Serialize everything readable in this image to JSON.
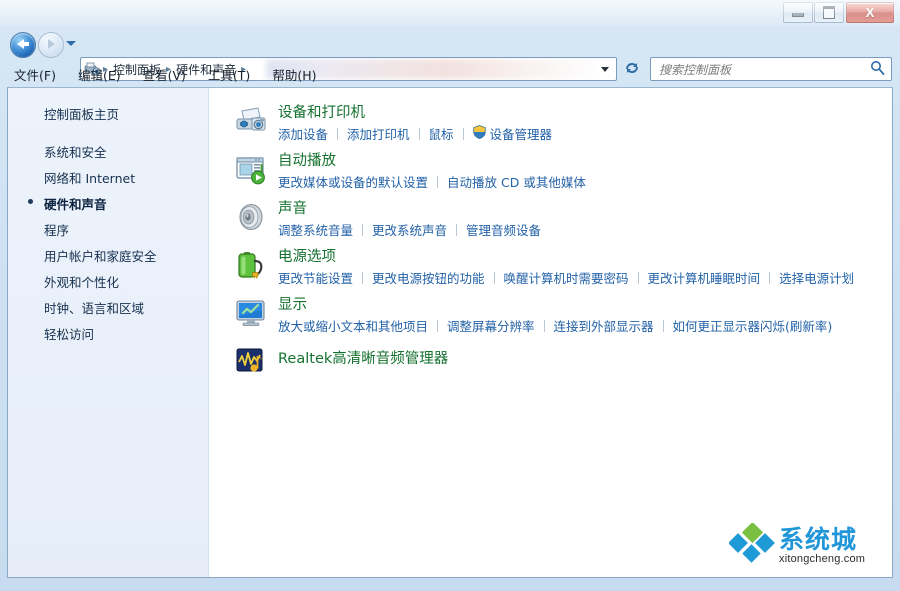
{
  "window": {
    "controls": {
      "minimize_label": "–",
      "maximize_label": "",
      "close_label": "X"
    }
  },
  "nav": {
    "back_tooltip": "后退",
    "forward_tooltip": "前进",
    "breadcrumbs": [
      "控制面板",
      "硬件和声音"
    ],
    "separator": "▸",
    "refresh_label": "↻"
  },
  "search": {
    "placeholder": "搜索控制面板"
  },
  "menubar": {
    "items": [
      "文件(F)",
      "编辑(E)",
      "查看(V)",
      "工具(T)",
      "帮助(H)"
    ]
  },
  "sidebar": {
    "home": "控制面板主页",
    "items": [
      {
        "label": "系统和安全",
        "active": false
      },
      {
        "label": "网络和 Internet",
        "active": false
      },
      {
        "label": "硬件和声音",
        "active": true
      },
      {
        "label": "程序",
        "active": false
      },
      {
        "label": "用户帐户和家庭安全",
        "active": false
      },
      {
        "label": "外观和个性化",
        "active": false
      },
      {
        "label": "时钟、语言和区域",
        "active": false
      },
      {
        "label": "轻松访问",
        "active": false
      }
    ]
  },
  "main": {
    "categories": [
      {
        "icon": "devices-and-printers-icon",
        "title": "设备和打印机",
        "links": [
          {
            "label": "添加设备",
            "shield": false
          },
          {
            "label": "添加打印机",
            "shield": false
          },
          {
            "label": "鼠标",
            "shield": false
          },
          {
            "label": "设备管理器",
            "shield": true
          }
        ]
      },
      {
        "icon": "autoplay-icon",
        "title": "自动播放",
        "links": [
          {
            "label": "更改媒体或设备的默认设置",
            "shield": false
          },
          {
            "label": "自动播放 CD 或其他媒体",
            "shield": false
          }
        ]
      },
      {
        "icon": "sound-speaker-icon",
        "title": "声音",
        "links": [
          {
            "label": "调整系统音量",
            "shield": false
          },
          {
            "label": "更改系统声音",
            "shield": false
          },
          {
            "label": "管理音频设备",
            "shield": false
          }
        ]
      },
      {
        "icon": "power-battery-icon",
        "title": "电源选项",
        "links": [
          {
            "label": "更改节能设置",
            "shield": false
          },
          {
            "label": "更改电源按钮的功能",
            "shield": false
          },
          {
            "label": "唤醒计算机时需要密码",
            "shield": false
          },
          {
            "label": "更改计算机睡眠时间",
            "shield": false
          },
          {
            "label": "选择电源计划",
            "shield": false
          }
        ]
      },
      {
        "icon": "display-monitor-icon",
        "title": "显示",
        "links": [
          {
            "label": "放大或缩小文本和其他项目",
            "shield": false
          },
          {
            "label": "调整屏幕分辨率",
            "shield": false
          },
          {
            "label": "连接到外部显示器",
            "shield": false
          },
          {
            "label": "如何更正显示器闪烁(刷新率)",
            "shield": false
          }
        ]
      },
      {
        "icon": "realtek-audio-icon",
        "title": "Realtek高清晰音频管理器",
        "links": []
      }
    ]
  },
  "watermark": {
    "text_cn_1": "系统",
    "text_cn_2": "城",
    "url": "xitongcheng.com"
  },
  "colors": {
    "category_title": "#15712f",
    "link": "#2362a8",
    "sidebar_text": "#16304f",
    "accent_blue": "#2196d8",
    "accent_green": "#7bc043",
    "close_red": "#bc3a31"
  }
}
